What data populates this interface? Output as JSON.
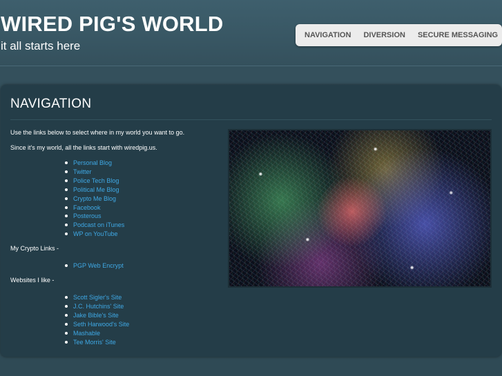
{
  "header": {
    "title": "WIRED PIG'S WORLD",
    "tagline": "it all starts here"
  },
  "nav": {
    "items": [
      "NAVIGATION",
      "DIVERSION",
      "SECURE MESSAGING"
    ]
  },
  "main": {
    "heading": "NAVIGATION",
    "intro1": "Use the links below to select where in my world you want to go.",
    "intro2": "Since it's my world, all the links start with wiredpig.us.",
    "links": [
      "Personal Blog",
      "Twitter",
      "Police Tech Blog",
      "Political Me Blog",
      "Crypto Me Blog",
      "Facebook",
      "Posterous",
      "Podcast on iTunes",
      "WP on YouTube"
    ],
    "crypto_label": "My Crypto Links -",
    "crypto_links": [
      "PGP Web Encrypt"
    ],
    "websites_label": "Websites I like -",
    "websites": [
      "Scott Sigler's Site",
      "J.C. Hutchins' Site",
      "Jake Bible's Site",
      "Seth Harwood's Site",
      "Mashable",
      "Tee Morris' Site"
    ]
  },
  "colors": {
    "link": "#3fa9e6",
    "panel": "#243d48",
    "background": "#35525e"
  }
}
